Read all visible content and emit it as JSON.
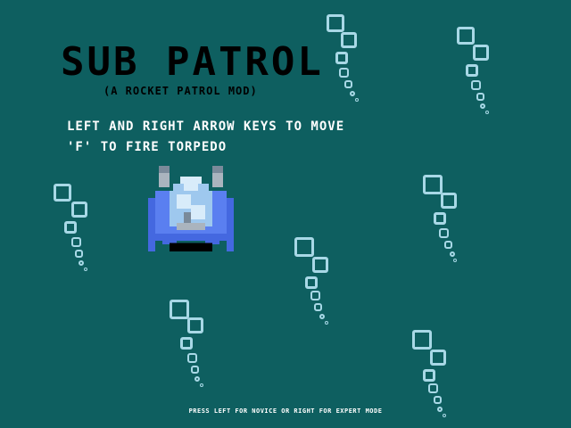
{
  "title": "SUB PATROL",
  "subtitle": "(A ROCKET PATROL MOD)",
  "instructions": {
    "move": "LEFT AND RIGHT ARROW KEYS TO MOVE",
    "fire": "'F' TO FIRE TORPEDO"
  },
  "footer": "PRESS LEFT FOR NOVICE OR RIGHT FOR EXPERT MODE",
  "colors": {
    "background": "#0e5f60",
    "bubble": "#a8d8e6",
    "sub_body": "#5a7ff0",
    "sub_light": "#d8ecfa",
    "sub_mid": "#9ec8ee",
    "sub_grey": "#7a8a9a"
  },
  "icons": [
    "bubble-trail-icon",
    "submarine-icon"
  ]
}
